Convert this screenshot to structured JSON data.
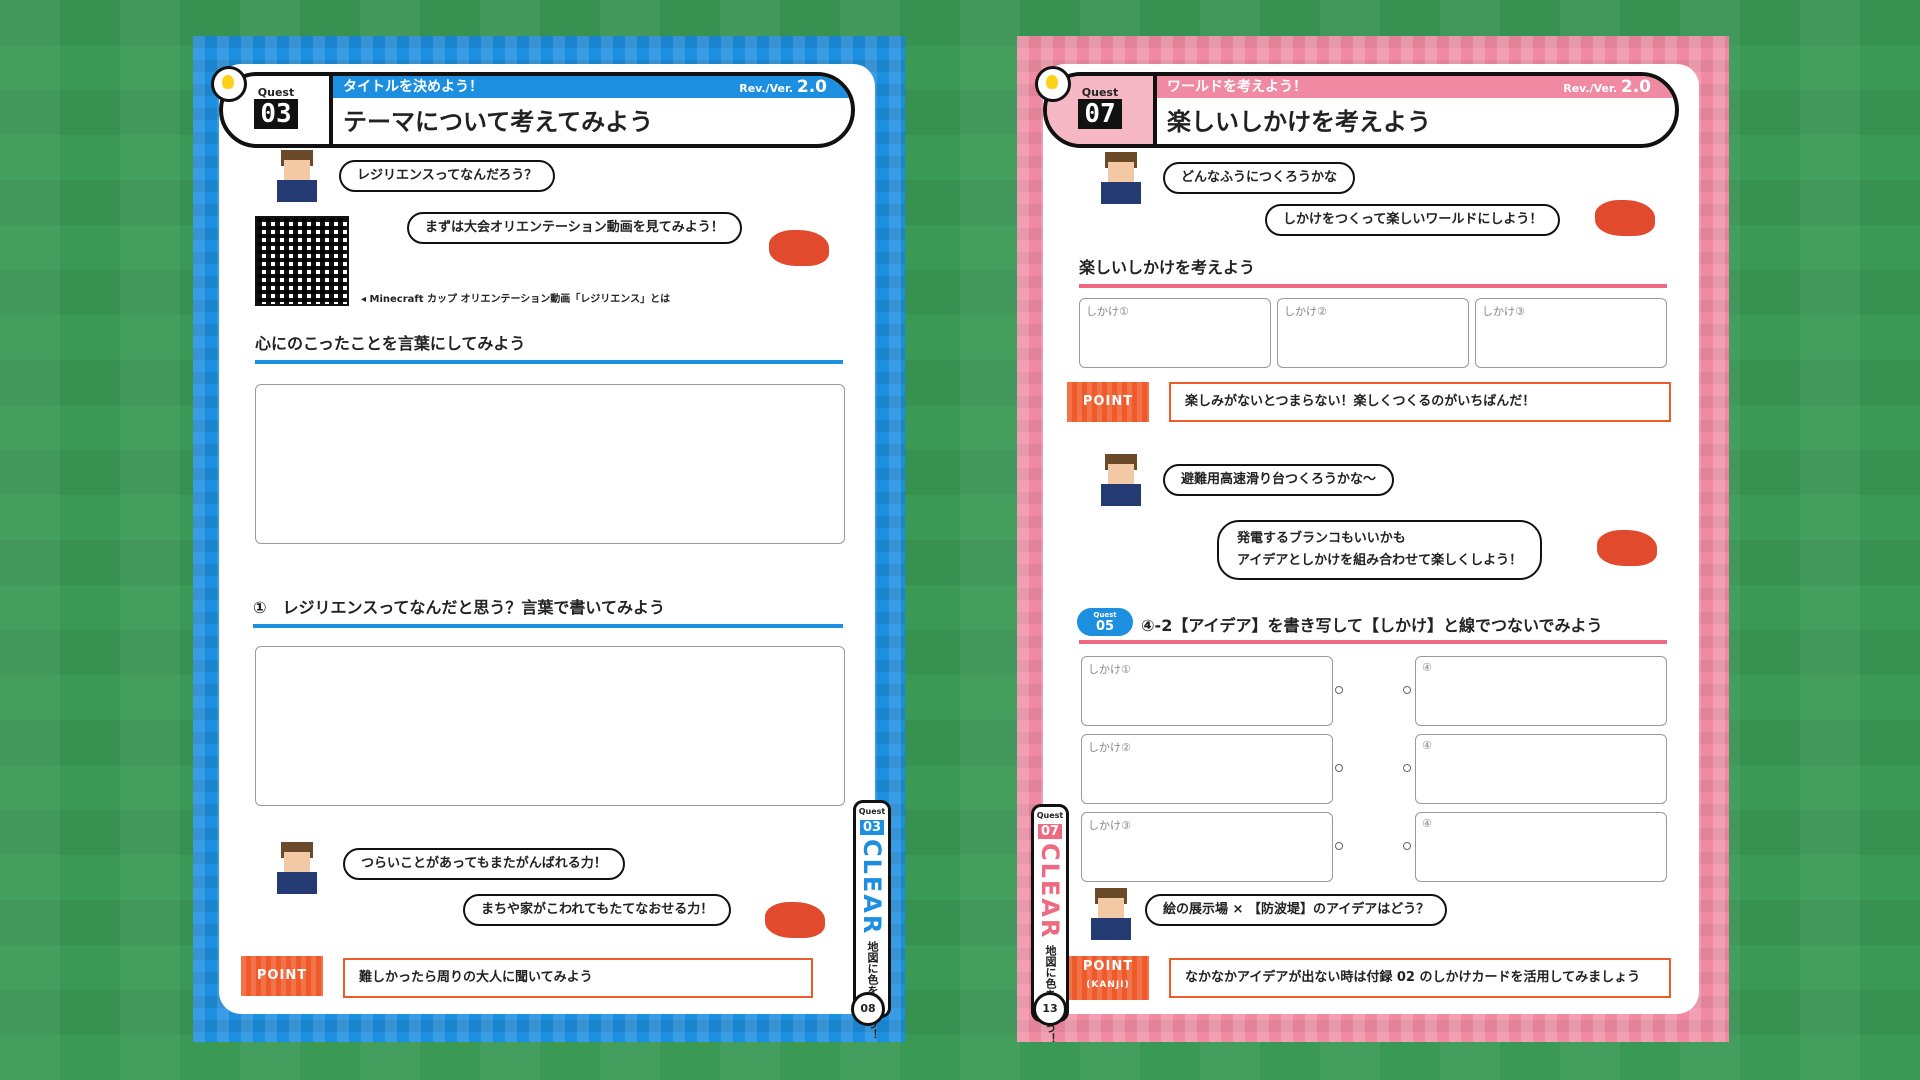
{
  "left": {
    "quest_label": "Quest",
    "quest_num": "03",
    "strip": "タイトルを決めよう！",
    "rev_label": "Rev./Ver.",
    "rev_num": "2.0",
    "title": "テーマについて考えてみよう",
    "bubble1": "レジリエンスってなんだろう？",
    "bubble2": "まずは大会オリエンテーション動画を見てみよう！",
    "qr_caption": "◂ Minecraft カップ オリエンテーション動画「レジリエンス」とは",
    "heading1": "心にのこったことを言葉にしてみよう",
    "heading2": "①　レジリエンスってなんだと思う？言葉で書いてみよう",
    "bubble3": "つらいことがあってもまたがんばれる力！",
    "bubble4": "まちや家がこわれてもたてなおせる力！",
    "point": "POINT",
    "point_text": "難しかったら周りの大人に聞いてみよう",
    "clear_quest": "Quest",
    "clear_num": "03",
    "clear_word": "CLEAR",
    "clear_text": "地図に色をぬろう！",
    "page": "08"
  },
  "right": {
    "quest_label": "Quest",
    "quest_num": "07",
    "strip": "ワールドを考えよう！",
    "rev_label": "Rev./Ver.",
    "rev_num": "2.0",
    "title": "楽しいしかけを考えよう",
    "bubble1": "どんなふうにつくろうかな",
    "bubble2": "しかけをつくって楽しいワールドにしよう！",
    "heading1": "楽しいしかけを考えよう",
    "box1": "しかけ①",
    "box2": "しかけ②",
    "box3": "しかけ③",
    "point": "POINT",
    "point_text1": "楽しみがないとつまらない！楽しくつくるのがいちばんだ！",
    "bubble3": "避難用高速滑り台つくろうかな〜",
    "bubble4a": "発電するブランコもいいかも",
    "bubble4b": "アイデアとしかけを組み合わせて楽しくしよう！",
    "mini_quest": "Quest",
    "mini_num": "05",
    "heading2": "④-2【アイデア】を書き写して【しかけ】と線でつないでみよう",
    "match_left": [
      "しかけ①",
      "しかけ②",
      "しかけ③"
    ],
    "match_right": [
      "④",
      "④",
      "④"
    ],
    "bubble5": "絵の展示場 × 【防波堤】のアイデアはどう？",
    "point2": "POINT",
    "point2_sub": "(KANJI)",
    "point_text2": "なかなかアイデアが出ない時は付録 02 のしかけカードを活用してみましょう",
    "clear_quest": "Quest",
    "clear_num": "07",
    "clear_word": "CLEAR",
    "clear_text": "地図に色をぬろう！",
    "page": "13"
  }
}
